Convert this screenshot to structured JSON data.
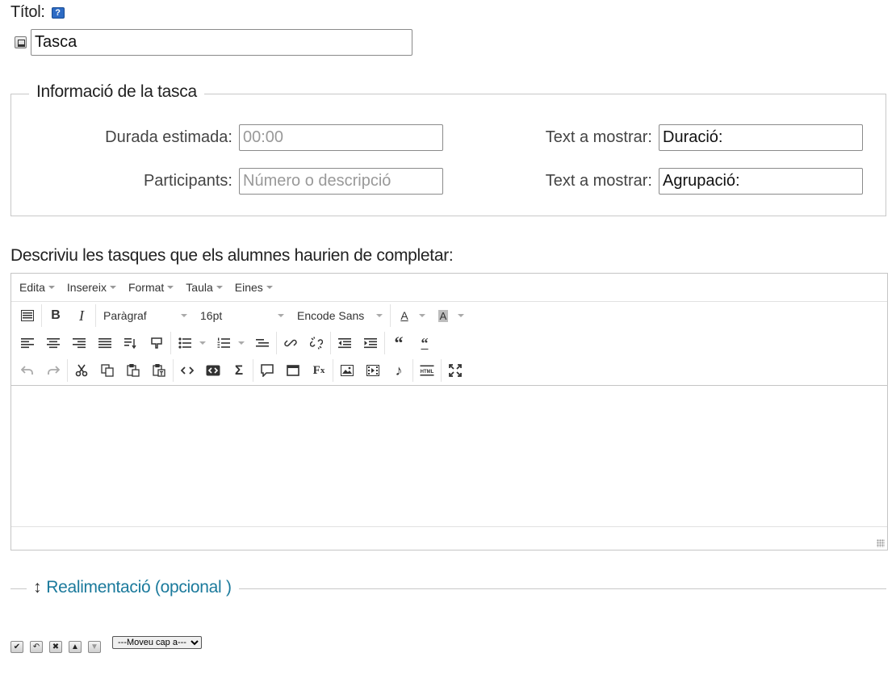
{
  "title": {
    "label": "Títol:",
    "help_icon": "help-icon",
    "value": "Tasca"
  },
  "task_info": {
    "legend": "Informació de la tasca",
    "duration_label": "Durada estimada:",
    "duration_placeholder": "00:00",
    "duration_text_label": "Text a mostrar:",
    "duration_text_value": "Duració:",
    "participants_label": "Participants:",
    "participants_placeholder": "Número o descripció",
    "participants_text_label": "Text a mostrar:",
    "participants_text_value": "Agrupació:"
  },
  "description": {
    "label": "Descriviu les tasques que els alumnes haurien de completar:"
  },
  "editor": {
    "menu": [
      "Edita",
      "Insereix",
      "Format",
      "Taula",
      "Eines"
    ],
    "paragraph_select": "Paràgraf",
    "size_select": "16pt",
    "font_select": "Encode Sans"
  },
  "feedback": {
    "label": "Realimentació (opcional )"
  },
  "move": {
    "select_value": "---Moveu cap a---"
  }
}
